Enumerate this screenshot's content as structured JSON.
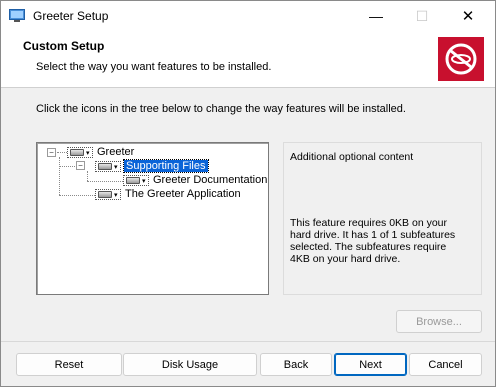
{
  "window": {
    "title": "Greeter Setup",
    "min_glyph": "—",
    "max_glyph": "☐",
    "close_glyph": "✕",
    "icon": "installer-icon"
  },
  "banner": {
    "title": "Custom Setup",
    "subtitle": "Select the way you want features to be installed.",
    "logo_icon": "no-symbol-logo",
    "logo_color": "#c8102e"
  },
  "instructions": "Click the icons in the tree below to change the way features will be installed.",
  "tree": {
    "items": [
      {
        "label": "Greeter",
        "selected": false
      },
      {
        "label": "Supporting Files",
        "selected": true
      },
      {
        "label": "Greeter Documentation",
        "selected": false
      },
      {
        "label": "The Greeter Application",
        "selected": false
      }
    ],
    "collapse_glyph": "−",
    "caret_glyph": "▾",
    "selection_color": "#0a64d8"
  },
  "info": {
    "description": "Additional optional content",
    "size_text": "This feature requires 0KB on your hard drive. It has 1 of 1 subfeatures selected. The subfeatures require 4KB on your hard drive."
  },
  "buttons": {
    "browse": "Browse...",
    "reset": "Reset",
    "disk_usage": "Disk Usage",
    "back": "Back",
    "next": "Next",
    "cancel": "Cancel"
  }
}
